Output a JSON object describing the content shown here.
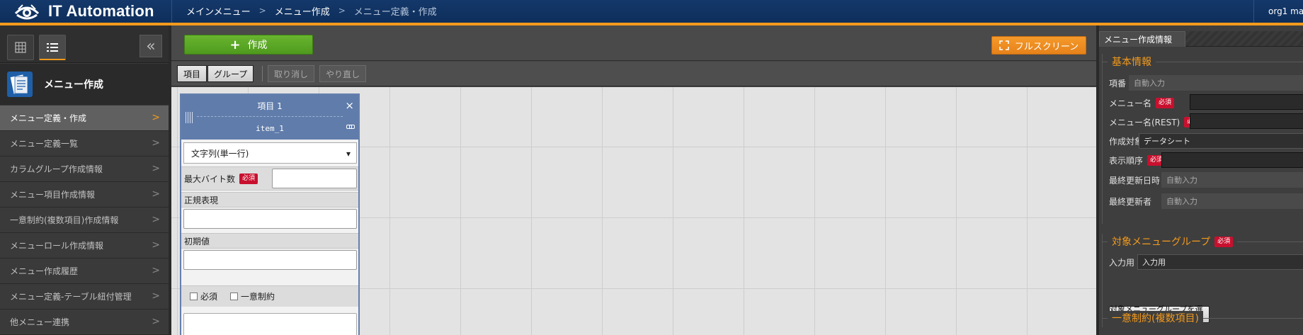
{
  "app": {
    "title": "IT Automation"
  },
  "breadcrumbs": [
    "メインメニュー",
    "メニュー作成",
    "メニュー定義・作成"
  ],
  "user": {
    "name": "org1 ma"
  },
  "sidebar": {
    "heading": "メニュー作成",
    "items": [
      {
        "label": "メニュー定義・作成",
        "active": true
      },
      {
        "label": "メニュー定義一覧"
      },
      {
        "label": "カラムグループ作成情報"
      },
      {
        "label": "メニュー項目作成情報"
      },
      {
        "label": "一意制約(複数項目)作成情報"
      },
      {
        "label": "メニューロール作成情報"
      },
      {
        "label": "メニュー作成履歴"
      },
      {
        "label": "メニュー定義-テーブル紐付管理"
      },
      {
        "label": "他メニュー連携"
      }
    ]
  },
  "main": {
    "create_label": "作成",
    "fullscreen_label": "フルスクリーン",
    "toolbar": {
      "item": "項目",
      "group": "グループ",
      "undo": "取り消し",
      "redo": "やり直し"
    }
  },
  "column_card": {
    "title": "項目 1",
    "rest_name": "item_1",
    "close": "×",
    "input_method": "文字列(単一行)",
    "max_bytes_label": "最大バイト数",
    "required_badge": "必須",
    "regex_label": "正規表現",
    "default_label": "初期値",
    "required_check": "必須",
    "unique_check": "一意制約"
  },
  "right_panel": {
    "tab": "メニュー作成情報",
    "basic_info": {
      "heading": "基本情報",
      "item_no_label": "項番",
      "item_no_value": "自動入力",
      "menu_name_label": "メニュー名",
      "menu_name_rest_label": "メニュー名(REST)",
      "target_label": "作成対象",
      "target_value": "データシート",
      "display_order_label": "表示順序",
      "last_update_label": "最終更新日時",
      "last_update_value": "自動入力",
      "last_updater_label": "最終更新者",
      "last_updater_value": "自動入力",
      "required_badge": "必須"
    },
    "menu_group": {
      "heading": "対象メニューグループ",
      "required_badge": "必須",
      "input_label": "入力用",
      "input_value": "入力用",
      "select_button": "対象メニューグループを選択"
    },
    "unique": {
      "heading": "一意制約(複数項目)"
    }
  },
  "colors": {
    "accent": "#f39a1c",
    "header": "#14386a",
    "create": "#5aa524",
    "required": "#c8102e"
  }
}
